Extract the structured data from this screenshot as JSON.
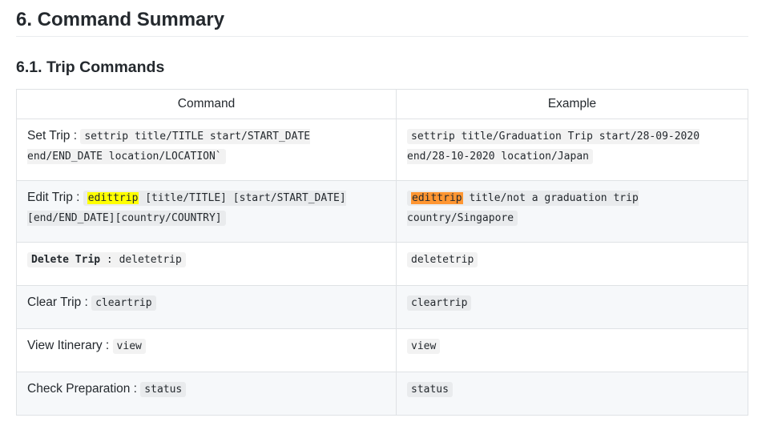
{
  "heading": {
    "title": "6. Command Summary",
    "subtitle": "6.1. Trip Commands"
  },
  "table": {
    "headers": {
      "command": "Command",
      "example": "Example"
    },
    "rows": [
      {
        "label": "Set Trip",
        "separator": " : ",
        "command_code": "settrip title/TITLE start/START_DATE end/END_DATE location/LOCATION`",
        "example_code": "settrip title/Graduation Trip start/28-09-2020 end/28-10-2020 location/Japan"
      },
      {
        "label": "Edit Trip",
        "separator": " : ",
        "command_highlight": "edittrip",
        "command_rest": " [title/TITLE] [start/START_DATE] [end/END_DATE][country/COUNTRY]",
        "example_highlight": "edittrip",
        "example_rest": " title/not a graduation trip country/Singapore"
      },
      {
        "label_code": "Delete Trip",
        "separator_code": " : deletetrip",
        "example_code": "deletetrip"
      },
      {
        "label": "Clear Trip",
        "separator": " : ",
        "command_code": "cleartrip",
        "example_code": "cleartrip"
      },
      {
        "label": "View Itinerary",
        "separator": " : ",
        "command_code": "view",
        "example_code": "view"
      },
      {
        "label": "Check Preparation",
        "separator": " : ",
        "command_code": "status",
        "example_code": "status"
      }
    ]
  },
  "colors": {
    "highlight_yellow": "#ffff00",
    "highlight_orange": "#ff9632",
    "zebra_row": "#f6f8fa",
    "border": "#dfe2e5"
  }
}
